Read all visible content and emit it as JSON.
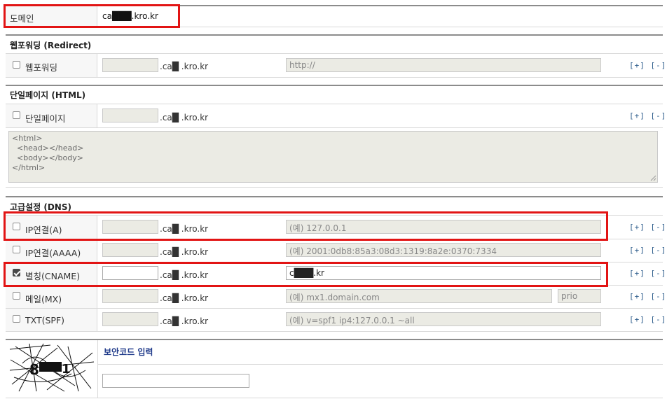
{
  "domain": {
    "label": "도메인",
    "value": "ca███.kro.kr"
  },
  "sections": {
    "redirect": {
      "title": "웹포워딩 (Redirect)"
    },
    "html": {
      "title": "단일페이지 (HTML)",
      "content": "<html>\n  <head></head>\n  <body></body>\n</html>"
    },
    "dns": {
      "title": "고급설정 (DNS)"
    }
  },
  "rows": {
    "webforward": {
      "label": "웹포워딩",
      "checked": false,
      "suffix": ".ca█  .kro.kr",
      "value_placeholder": "http://"
    },
    "singlepage": {
      "label": "단일페이지",
      "checked": false,
      "suffix": ".ca█  .kro.kr"
    },
    "ip_a": {
      "label": "IP연결(A)",
      "checked": false,
      "suffix": ".ca█  .kro.kr",
      "value_placeholder": "(예) 127.0.0.1"
    },
    "ip_aaaa": {
      "label": "IP연결(AAAA)",
      "checked": false,
      "suffix": ".ca█  .kro.kr",
      "value_placeholder": "(예) 2001:0db8:85a3:08d3:1319:8a2e:0370:7334"
    },
    "cname": {
      "label": "별칭(CNAME)",
      "checked": true,
      "suffix": ".ca█  .kro.kr",
      "value": "c███.kr"
    },
    "mx": {
      "label": "메일(MX)",
      "checked": false,
      "suffix": ".ca█  .kro.kr",
      "value_placeholder": "(예) mx1.domain.com",
      "prio_placeholder": "prio"
    },
    "spf": {
      "label": "TXT(SPF)",
      "checked": false,
      "suffix": ".ca█  .kro.kr",
      "value_placeholder": "(예) v=spf1 ip4:127.0.0.1 ~all"
    }
  },
  "row_actions": {
    "add": "[+]",
    "remove": "[-]"
  },
  "security": {
    "title": "보안코드 입력",
    "captcha_icon": "captcha-image"
  },
  "colors": {
    "highlight": "#e21414",
    "security_title": "#1f3a8a",
    "actions": "#2a5a8a"
  }
}
